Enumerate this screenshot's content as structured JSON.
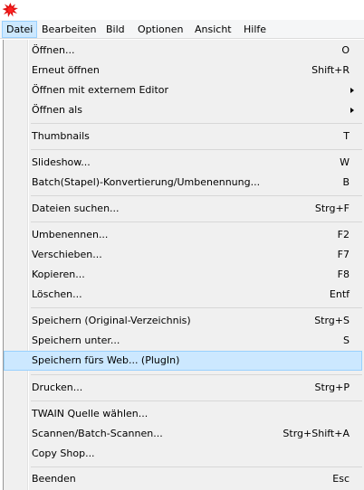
{
  "menubar": {
    "items": [
      {
        "label": "Datei",
        "active": true
      },
      {
        "label": "Bearbeiten",
        "active": false
      },
      {
        "label": "Bild",
        "active": false
      },
      {
        "label": "Optionen",
        "active": false
      },
      {
        "label": "Ansicht",
        "active": false
      },
      {
        "label": "Hilfe",
        "active": false
      }
    ]
  },
  "menu": {
    "items": [
      {
        "label": "Öffnen...",
        "shortcut": "O"
      },
      {
        "label": "Erneut öffnen",
        "shortcut": "Shift+R"
      },
      {
        "label": "Öffnen mit externem Editor",
        "shortcut": "",
        "submenu": true
      },
      {
        "label": "Öffnen als",
        "shortcut": "",
        "submenu": true
      },
      {
        "label": "Thumbnails",
        "shortcut": "T"
      },
      {
        "label": "Slideshow...",
        "shortcut": "W"
      },
      {
        "label": "Batch(Stapel)-Konvertierung/Umbenennung...",
        "shortcut": "B"
      },
      {
        "label": "Dateien suchen...",
        "shortcut": "Strg+F"
      },
      {
        "label": "Umbenennen...",
        "shortcut": "F2"
      },
      {
        "label": "Verschieben...",
        "shortcut": "F7"
      },
      {
        "label": "Kopieren...",
        "shortcut": "F8"
      },
      {
        "label": "Löschen...",
        "shortcut": "Entf"
      },
      {
        "label": "Speichern (Original-Verzeichnis)",
        "shortcut": "Strg+S"
      },
      {
        "label": "Speichern unter...",
        "shortcut": "S"
      },
      {
        "label": "Speichern fürs Web... (PlugIn)",
        "shortcut": "",
        "highlighted": true
      },
      {
        "label": "Drucken...",
        "shortcut": "Strg+P"
      },
      {
        "label": "TWAIN Quelle wählen...",
        "shortcut": ""
      },
      {
        "label": "Scannen/Batch-Scannen...",
        "shortcut": "Strg+Shift+A"
      },
      {
        "label": "Copy Shop...",
        "shortcut": ""
      },
      {
        "label": "Beenden",
        "shortcut": "Esc"
      }
    ]
  },
  "colors": {
    "highlight": "#cce8ff",
    "highlight_border": "#99d1ff",
    "menu_bg": "#f0f0f0"
  },
  "icons": {
    "app": "irfanview-red-splash-icon"
  }
}
